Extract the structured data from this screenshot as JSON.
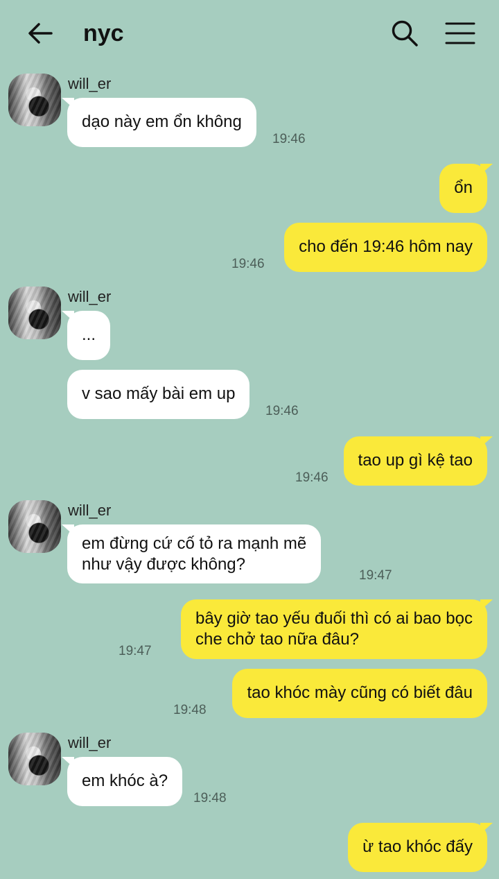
{
  "header": {
    "title": "nyc",
    "back_icon": "arrow-left-icon",
    "search_icon": "search-icon",
    "menu_icon": "hamburger-menu-icon"
  },
  "colors": {
    "background": "#a6cdbf",
    "incoming_bubble": "#ffffff",
    "outgoing_bubble": "#fae93a",
    "timestamp": "#4c5e58"
  },
  "messages": [
    {
      "from": "will_er",
      "sender_label": "will_er",
      "text": "dạo này em ổn không",
      "time": "19:46"
    },
    {
      "from": "me",
      "text": "ổn",
      "time": ""
    },
    {
      "from": "me",
      "text": "cho đến 19:46 hôm nay",
      "time": "19:46"
    },
    {
      "from": "will_er",
      "sender_label": "will_er",
      "text": "...",
      "time": ""
    },
    {
      "from": "will_er",
      "text": "v sao mấy bài em up",
      "time": "19:46"
    },
    {
      "from": "me",
      "text": "tao up gì kệ tao",
      "time": "19:46"
    },
    {
      "from": "will_er",
      "sender_label": "will_er",
      "lines": [
        "em đừng cứ cố tỏ ra mạnh mẽ",
        "như vậy được không?"
      ],
      "time": "19:47"
    },
    {
      "from": "me",
      "lines": [
        "bây giờ tao yếu đuối thì có ai bao bọc",
        "che chở tao nữa đâu?"
      ],
      "time": "19:47"
    },
    {
      "from": "me",
      "text": "tao khóc mày cũng có biết đâu",
      "time": "19:48"
    },
    {
      "from": "will_er",
      "sender_label": "will_er",
      "text": "em khóc à?",
      "time": "19:48"
    },
    {
      "from": "me",
      "text": "ừ tao khóc đấy",
      "time": ""
    }
  ]
}
